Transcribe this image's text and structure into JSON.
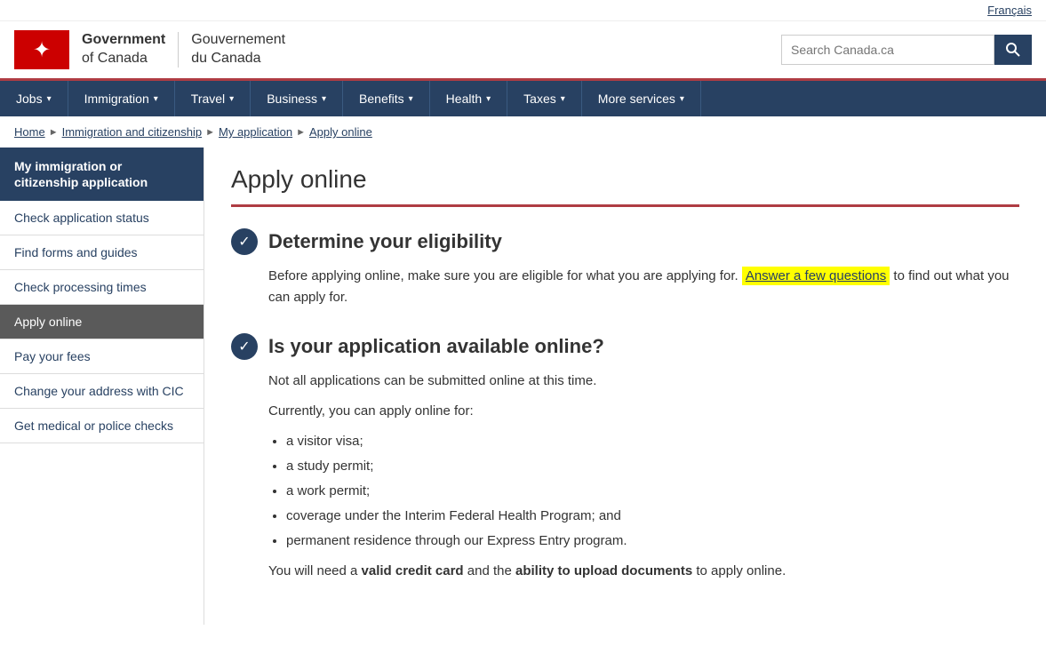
{
  "topbar": {
    "language_link": "Français"
  },
  "header": {
    "gov_en_line1": "Government",
    "gov_en_line2": "of Canada",
    "gov_fr_line1": "Gouvernement",
    "gov_fr_line2": "du Canada",
    "search_placeholder": "Search Canada.ca"
  },
  "nav": {
    "items": [
      {
        "label": "Jobs",
        "has_arrow": true
      },
      {
        "label": "Immigration",
        "has_arrow": true
      },
      {
        "label": "Travel",
        "has_arrow": true
      },
      {
        "label": "Business",
        "has_arrow": true
      },
      {
        "label": "Benefits",
        "has_arrow": true
      },
      {
        "label": "Health",
        "has_arrow": true
      },
      {
        "label": "Taxes",
        "has_arrow": true
      },
      {
        "label": "More services",
        "has_arrow": true
      }
    ]
  },
  "breadcrumb": {
    "items": [
      {
        "label": "Home",
        "href": "#"
      },
      {
        "label": "Immigration and citizenship",
        "href": "#"
      },
      {
        "label": "My application",
        "href": "#"
      },
      {
        "label": "Apply online",
        "href": "#"
      }
    ]
  },
  "sidebar": {
    "header_label": "My immigration or citizenship application",
    "items": [
      {
        "label": "Check application status",
        "active": false
      },
      {
        "label": "Find forms and guides",
        "active": false
      },
      {
        "label": "Check processing times",
        "active": false
      },
      {
        "label": "Apply online",
        "active": true
      },
      {
        "label": "Pay your fees",
        "active": false
      },
      {
        "label": "Change your address with CIC",
        "active": false
      },
      {
        "label": "Get medical or police checks",
        "active": false
      }
    ]
  },
  "content": {
    "page_title": "Apply online",
    "section1": {
      "title": "Determine your eligibility",
      "body_intro": "Before applying online, make sure you are eligible for what you are applying for.",
      "link_text": "Answer a few questions",
      "body_suffix": "to find out what you can apply for."
    },
    "section2": {
      "title": "Is your application available online?",
      "para1": "Not all applications can be submitted online at this time.",
      "para2": "Currently, you can apply online for:",
      "list_items": [
        "a visitor visa;",
        "a study permit;",
        "a work permit;",
        "coverage under the Interim Federal Health Program; and",
        "permanent residence through our Express Entry program."
      ],
      "para3_prefix": "You will need a ",
      "bold1": "valid credit card",
      "para3_mid": " and the ",
      "bold2": "ability to upload documents",
      "para3_suffix": " to apply online."
    }
  }
}
